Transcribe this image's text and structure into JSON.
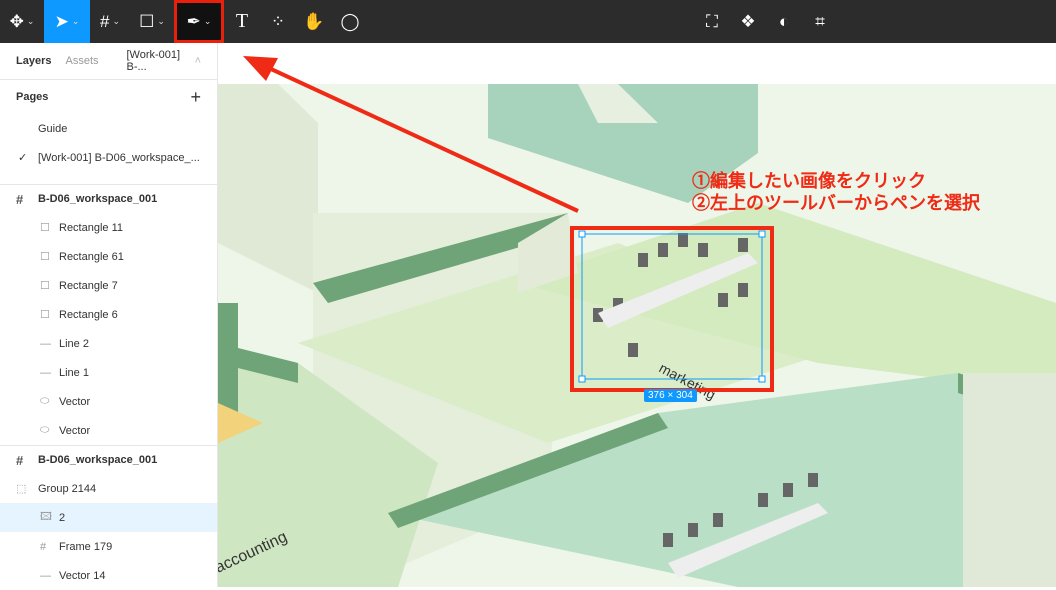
{
  "toolbar": {
    "tools": [
      "main-menu",
      "move",
      "frame",
      "shape",
      "pen",
      "text",
      "resources",
      "hand",
      "comment"
    ],
    "right_tools": [
      "component",
      "instance",
      "mask",
      "crop"
    ]
  },
  "sidebar": {
    "tabs": {
      "layers": "Layers",
      "assets": "Assets",
      "file": "[Work-001] B-..."
    },
    "pages_title": "Pages",
    "pages": [
      "Guide",
      "[Work-001] B-D06_workspace_..."
    ],
    "layers": [
      {
        "type": "frame",
        "name": "B-D06_workspace_001"
      },
      {
        "type": "rect",
        "name": "Rectangle 11"
      },
      {
        "type": "rect",
        "name": "Rectangle 61"
      },
      {
        "type": "rect",
        "name": "Rectangle 7"
      },
      {
        "type": "rect",
        "name": "Rectangle 6"
      },
      {
        "type": "line",
        "name": "Line 2"
      },
      {
        "type": "line",
        "name": "Line 1"
      },
      {
        "type": "vector",
        "name": "Vector"
      },
      {
        "type": "vector",
        "name": "Vector"
      },
      {
        "type": "frame",
        "name": "B-D06_workspace_001"
      },
      {
        "type": "group",
        "name": "Group 2144"
      },
      {
        "type": "image",
        "name": "2",
        "selected": true
      },
      {
        "type": "frame-sub",
        "name": "Frame 179"
      },
      {
        "type": "line",
        "name": "Vector 14"
      }
    ]
  },
  "canvas": {
    "instructions": [
      "①編集したい画像をクリック",
      "②左上のツールバーからペンを選択"
    ],
    "selection_size": "376 × 304",
    "labels": [
      "marketing",
      "accounting"
    ]
  },
  "colors": {
    "accent": "#0d99ff",
    "annotation": "#ef2b16"
  }
}
